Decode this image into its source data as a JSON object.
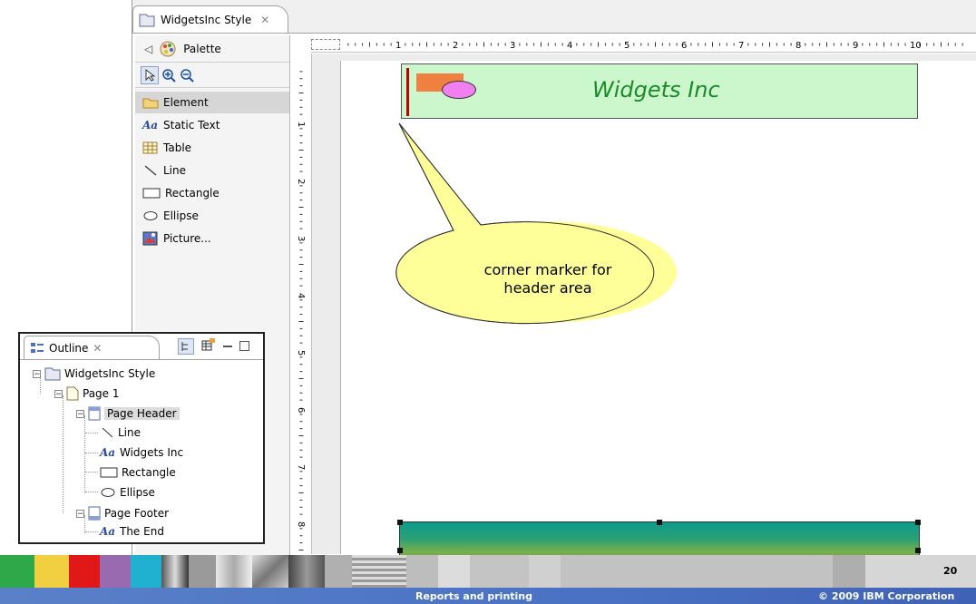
{
  "editor": {
    "tab_title": "WidgetsInc Style",
    "tab_close": "✕"
  },
  "palette": {
    "title": "Palette",
    "items": [
      {
        "label": "Element",
        "icon": "folder-icon"
      },
      {
        "label": "Static Text",
        "icon": "static-text-icon"
      },
      {
        "label": "Table",
        "icon": "table-icon"
      },
      {
        "label": "Line",
        "icon": "line-icon"
      },
      {
        "label": "Rectangle",
        "icon": "rectangle-icon"
      },
      {
        "label": "Ellipse",
        "icon": "ellipse-icon"
      },
      {
        "label": "Picture...",
        "icon": "picture-icon"
      }
    ]
  },
  "ruler": {
    "top_numbers": [
      "1",
      "2",
      "3",
      "4",
      "5",
      "6",
      "7",
      "8",
      "9",
      "10"
    ],
    "left_numbers": [
      "1",
      "2",
      "3",
      "4",
      "5",
      "6",
      "7",
      "8"
    ]
  },
  "canvas": {
    "header_text": "Widgets Inc",
    "header_colors": {
      "background": "#ccf6cc",
      "line": "#c00000",
      "rectangle": "#f08040",
      "ellipse": "#f080f0",
      "text": "#1b8a2a"
    }
  },
  "callout": {
    "line1": "corner marker for",
    "line2": "header area",
    "fill": "#ffff99"
  },
  "outline": {
    "title": "Outline",
    "close": "✕",
    "tree": [
      {
        "label": "WidgetsInc Style",
        "level": 0,
        "icon": "report-icon"
      },
      {
        "label": "Page 1",
        "level": 1,
        "icon": "page-icon"
      },
      {
        "label": "Page Header",
        "level": 2,
        "icon": "page-header-icon",
        "selected": true
      },
      {
        "label": "Line",
        "level": 3,
        "icon": "line-icon"
      },
      {
        "label": "Widgets Inc",
        "level": 3,
        "icon": "static-text-icon"
      },
      {
        "label": "Rectangle",
        "level": 3,
        "icon": "rectangle-icon"
      },
      {
        "label": "Ellipse",
        "level": 3,
        "icon": "ellipse-icon"
      },
      {
        "label": "Page Footer",
        "level": 2,
        "icon": "page-footer-icon"
      },
      {
        "label": "The End",
        "level": 3,
        "icon": "static-text-icon"
      }
    ]
  },
  "footer_bar": {
    "page_number": "20",
    "title": "Reports and printing",
    "copyright": "© 2009 IBM Corporation"
  }
}
